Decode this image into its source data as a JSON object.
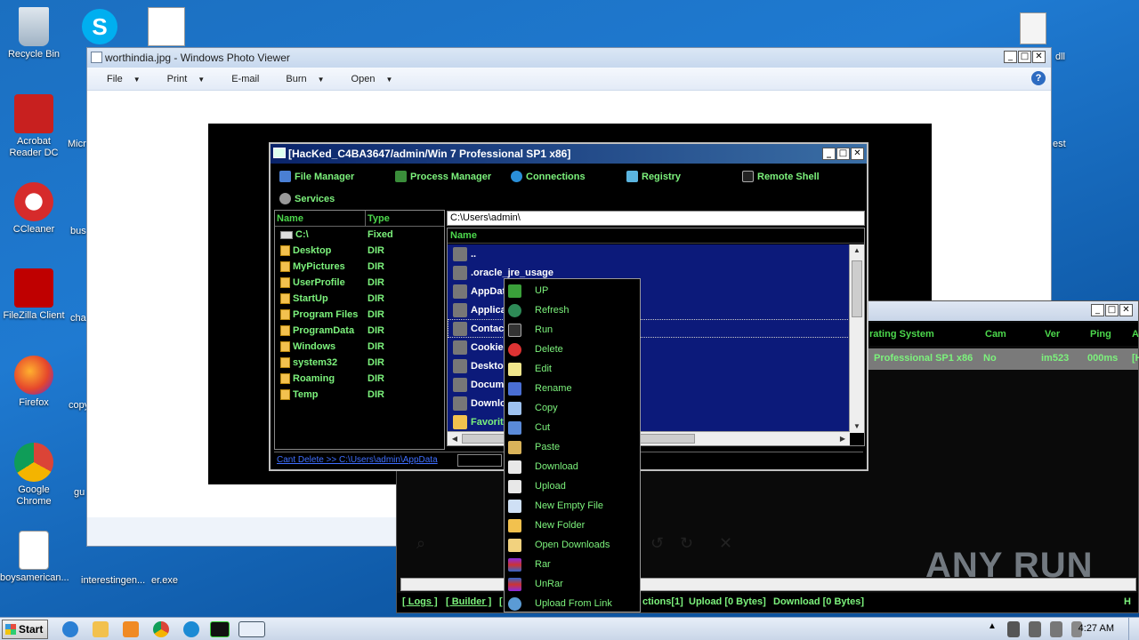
{
  "desktop": {
    "icons": [
      {
        "label": "Recycle Bin"
      },
      {
        "label": "Acrobat Reader DC"
      },
      {
        "label": "CCleaner"
      },
      {
        "label": "FileZilla Client"
      },
      {
        "label": "Firefox"
      },
      {
        "label": "Google Chrome"
      },
      {
        "label": "boysamerican..."
      }
    ],
    "partial_labels": [
      "Micr",
      "bus",
      "cha",
      "copy",
      "gu",
      "interestingen...",
      "er.exe",
      "dll",
      "est"
    ]
  },
  "photo_viewer": {
    "title": "worthindia.jpg - Windows Photo Viewer",
    "menu": [
      "File",
      "Print",
      "E-mail",
      "Burn",
      "Open"
    ]
  },
  "hacked_window": {
    "title": "[HacKed_C4BA3647/admin/Win 7 Professional SP1 x86]",
    "toolbar": [
      "File Manager",
      "Process Manager",
      "Connections",
      "Registry",
      "Remote Shell",
      "Services"
    ],
    "left_headers": [
      "Name",
      "Type"
    ],
    "drives": [
      {
        "name": "C:\\",
        "type": "Fixed"
      },
      {
        "name": "Desktop",
        "type": "DIR"
      },
      {
        "name": "MyPictures",
        "type": "DIR"
      },
      {
        "name": "UserProfile",
        "type": "DIR"
      },
      {
        "name": "StartUp",
        "type": "DIR"
      },
      {
        "name": "Program Files",
        "type": "DIR"
      },
      {
        "name": "ProgramData",
        "type": "DIR"
      },
      {
        "name": "Windows",
        "type": "DIR"
      },
      {
        "name": "system32",
        "type": "DIR"
      },
      {
        "name": "Roaming",
        "type": "DIR"
      },
      {
        "name": "Temp",
        "type": "DIR"
      }
    ],
    "path": "C:\\Users\\admin\\",
    "right_header": "Name",
    "files": [
      "..",
      ".oracle_jre_usage",
      "AppDat",
      "Applica",
      "Contac",
      "Cookie",
      "Deskto",
      "Docum",
      "Downlo",
      "Favorit"
    ],
    "status": "Cant Delete >> C:\\Users\\admin\\AppData"
  },
  "context_menu": {
    "items": [
      "UP",
      "Refresh",
      "Run",
      "Delete",
      "Edit",
      "Rename",
      "Copy",
      "Cut",
      "Paste",
      "Download",
      "Upload",
      "New Empty File",
      "New Folder",
      "Open Downloads",
      "Rar",
      "UnRar",
      "Upload From Link"
    ]
  },
  "bg_window": {
    "headers": [
      "rating System",
      "Cam",
      "Ver",
      "Ping",
      "A"
    ],
    "row": [
      "Professional SP1 x86",
      "No",
      "im523",
      "000ms",
      "[H"
    ],
    "status": [
      "[ Logs ]",
      "[ Builder ]",
      "[",
      "ctions[1]",
      "Upload [0 Bytes]",
      "Download [0 Bytes]",
      "H"
    ]
  },
  "taskbar": {
    "start": "Start",
    "clock": "4:27 AM"
  },
  "watermark": "ANY RUN"
}
